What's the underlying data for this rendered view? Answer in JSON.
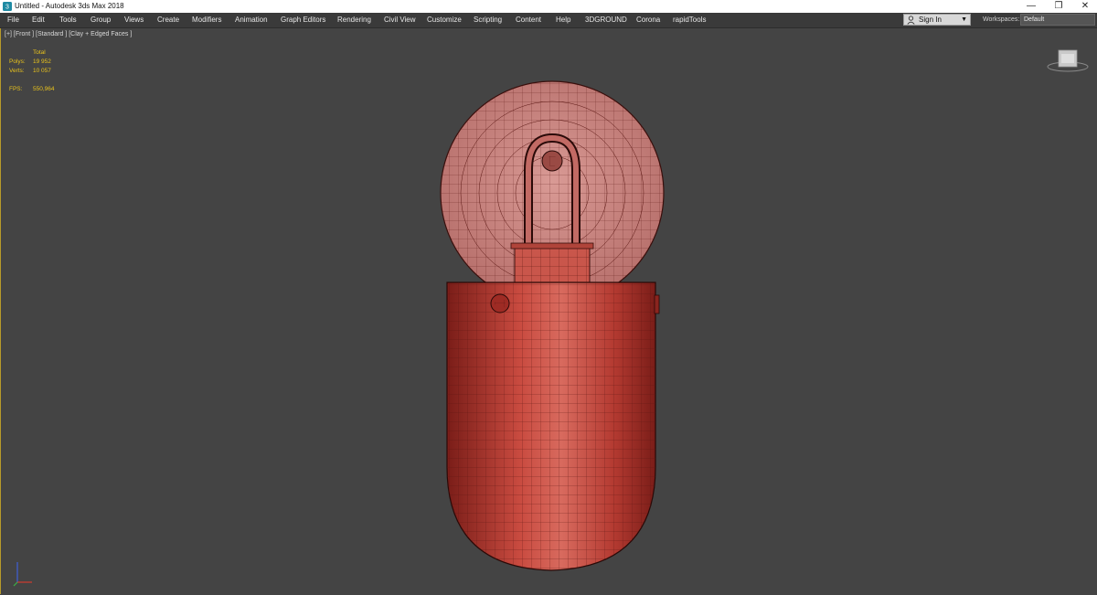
{
  "window": {
    "title": "Untitled - Autodesk 3ds Max 2018",
    "app_icon": "3dsmax-icon",
    "controls": {
      "minimize": "—",
      "maximize": "❐",
      "close": "✕"
    }
  },
  "menubar": {
    "items": [
      "File",
      "Edit",
      "Tools",
      "Group",
      "Views",
      "Create",
      "Modifiers",
      "Animation",
      "Graph Editors",
      "Rendering",
      "Civil View",
      "Customize",
      "Scripting",
      "Content",
      "Help",
      "3DGROUND",
      "Corona",
      "rapidTools"
    ],
    "sign_in": {
      "label": "Sign In",
      "icon": "person-icon"
    },
    "workspaces_label": "Workspaces:",
    "workspace_value": "Default"
  },
  "viewport": {
    "label": "[+] [Front ] [Standard ] [Clay + Edged Faces ]",
    "stats": {
      "header": "Total",
      "polys_label": "Polys:",
      "polys_value": "19 952",
      "verts_label": "Verts:",
      "verts_value": "10 057",
      "fps_label": "FPS:",
      "fps_value": "550,964"
    },
    "accent_color": "#e8c21c",
    "model_color": "#b8312a",
    "background_color": "#444444"
  }
}
